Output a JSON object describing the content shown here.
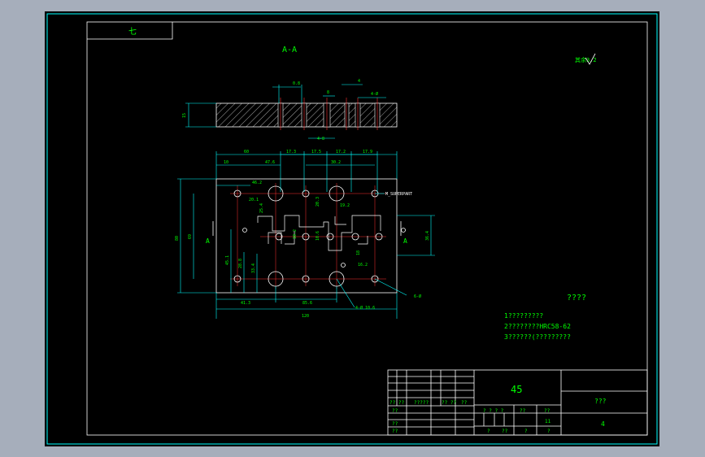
{
  "view_label": "A-A",
  "corner_tab": "七",
  "roughness_symbol": "其余3.2",
  "tech_heading": "????",
  "tech_notes": [
    "1?????????",
    "2????????HRC58-62",
    "3??????(?????????"
  ],
  "material": "45",
  "title_block": {
    "top_right": "???",
    "sheet_no": "4",
    "row_labels": [
      "?? ??",
      "?????",
      "?? ??",
      "??"
    ],
    "mid_labels": [
      "? ? ? ?",
      "??",
      "??",
      "11"
    ],
    "bottom_labels": [
      "?",
      "??",
      "?",
      "?"
    ],
    "left_col": [
      "??",
      "??",
      "??"
    ]
  },
  "dimensions": {
    "top_view": [
      "0.8",
      "8",
      "4",
      "4-Ø",
      "4-8"
    ],
    "thickness": "15",
    "horizontal_top": [
      "60",
      "17.3",
      "17.5",
      "17.2",
      "17.9"
    ],
    "horizontal_second": [
      "10",
      "47.6",
      "30.2",
      "46.2"
    ],
    "vertical_left": [
      "80",
      "69",
      "45.1",
      "28.8",
      "33.4"
    ],
    "vertical_right": [
      "36.4"
    ],
    "bottom_row": [
      "41.3",
      "85.6",
      "120"
    ],
    "inner": [
      "4-Ø 10.6",
      "6-Ø",
      "20.1",
      "10.2",
      "16.2",
      "20.3",
      "19.2",
      "18",
      "10.6",
      "25.4"
    ],
    "callout": "M_SUPERPART",
    "section_marks": [
      "A",
      "A"
    ]
  }
}
